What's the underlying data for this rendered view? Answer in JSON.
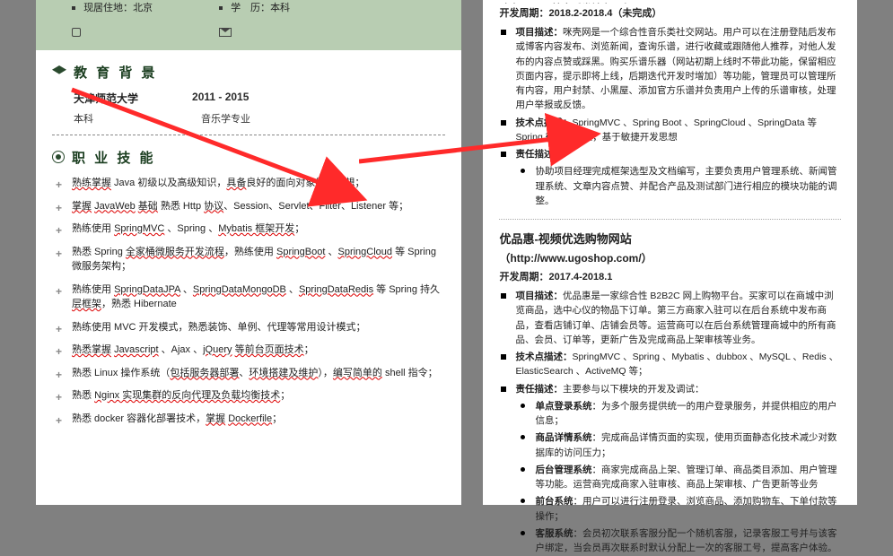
{
  "left": {
    "header": {
      "residence_label": "现居住地：",
      "residence": "北京",
      "edu_label": "学　历：",
      "edu": "本科"
    },
    "edu_section_title": "教 育 背 景",
    "education": {
      "school": "天津师范大学",
      "years": "2011 - 2015",
      "degree": "本科",
      "major": "音乐学专业"
    },
    "skill_section_title": "职 业 技 能",
    "skills": [
      {
        "p1": "熟练掌握 Java 初级以及高级知识，具备良好的面向对象编程思想；",
        "wavy": [
          "熟练掌握",
          "具备"
        ]
      },
      {
        "p1": "掌握 JavaWeb 基础 熟悉 Http 协议、Session、Servlet、Filter、Listener 等；",
        "wavy": [
          "掌握",
          "JavaWeb",
          "基础",
          "协议"
        ]
      },
      {
        "p1": "熟练使用 SpringMVC 、Spring 、Mybatis 框架开发；",
        "wavy": [
          "SpringMVC",
          "Mybatis 框架开发"
        ]
      },
      {
        "p1": "熟悉 Spring 全家桶微服务开发流程，熟练使用 SpringBoot 、SpringCloud 等 Spring 微服务架构；",
        "wavy": [
          "全家桶微服务开发流程",
          "SpringBoot",
          "SpringCloud"
        ]
      },
      {
        "p1": "熟练使用 SpringDataJPA 、SpringDataMongoDB 、SpringDataRedis 等 Spring 持久层框架，熟悉 Hibernate",
        "wavy": [
          "SpringDataJPA",
          "SpringDataMongoDB",
          "SpringDataRedis",
          "层框架"
        ]
      },
      {
        "p1": "熟练使用 MVC 开发模式，熟悉装饰、单例、代理等常用设计模式；",
        "wavy": []
      },
      {
        "p1": "熟悉掌握 Javascript 、Ajax 、jQuery 等前台页面技术；",
        "wavy": [
          "熟悉掌握",
          "Javascript",
          "jQuery",
          "等前台页面技术"
        ]
      },
      {
        "p1": "熟悉 Linux 操作系统（包括服务器部署、环境搭建及维护），编写简单的 shell 指令；",
        "wavy": [
          "包括服务器部署",
          "环境搭建及维护",
          "编写简单的"
        ]
      },
      {
        "p1": "熟悉 Nginx 实现集群的反向代理及负载均衡技术；",
        "wavy": [
          "Nginx 实现集群的反向代理及负载均衡技术"
        ]
      },
      {
        "p1": "熟悉 docker 容器化部署技术，掌握 Dockerfile；",
        "wavy": [
          "掌握",
          "Dockerfile"
        ]
      }
    ]
  },
  "right": {
    "proj1": {
      "title_prefix": "咪壳网-项目性音乐类社交平台",
      "period_label": "开发周期：",
      "period": "2018.2-2018.4（未完成）",
      "desc_label": "项目描述：",
      "desc": "咪壳网是一个综合性音乐类社交网站。用户可以在注册登陆后发布或博客内容发布、浏览新闻，查询乐谱，进行收藏或跟随他人推荐，对他人发布的内容点赞或踩黑。购买乐谱乐器（网站初期上线时不带此功能，保留相应页面内容，提示即将上线，后期迭代开发时增加）等功能，管理员可以管理所有内容，用户封禁、小黑屋、添加官方乐谱并负责用户上传的乐谱审核，处理用户举报或反馈。",
      "tech_label": "技术点描述：",
      "tech": "SpringMVC 、Spring Boot 、SpringCloud 、SpringData 等 Spring 微服务框架，基于敏捷开发思想",
      "resp_label": "责任描述：",
      "resp": "协助项目经理完成框架选型及文档编写，主要负责用户管理系统、新闻管理系统、文章内容点赞、并配合产品及测试部门进行相应的模块功能的调整。"
    },
    "proj2": {
      "title": "优品惠-视频优选购物网站",
      "url_label": "（http://www.ugoshop.com/）",
      "period_label": "开发周期：",
      "period": "2017.4-2018.1",
      "desc_label": "项目描述：",
      "desc": "优品惠是一家综合性 B2B2C 网上购物平台。买家可以在商城中浏览商品，选中心仪的物品下订单。第三方商家入驻可以在后台系统中发布商品，查看店铺订单、店铺会员等。运营商可以在后台系统管理商城中的所有商品、会员、订单等，更新广告及完成商品上架审核等业务。",
      "tech_label": "技术点描述：",
      "tech": "SpringMVC 、Spring 、Mybatis 、dubbox 、MySQL 、Redis 、ElasticSearch 、ActiveMQ 等；",
      "resp_label": "责任描述：",
      "resp_intro": "主要参与以下模块的开发及调试：",
      "modules": [
        {
          "name": "单点登录系统",
          "text": "：为多个服务提供统一的用户登录服务，并提供相应的用户信息；"
        },
        {
          "name": "商品详情系统",
          "text": "：完成商品详情页面的实现，使用页面静态化技术减少对数据库的访问压力；"
        },
        {
          "name": "后台管理系统",
          "text": "：商家完成商品上架、管理订单、商品类目添加、用户管理等功能。运营商完成商家入驻审核、商品上架审核、广告更新等业务"
        },
        {
          "name": "前台系统",
          "text": "：用户可以进行注册登录、浏览商品、添加购物车、下单付款等操作；"
        },
        {
          "name": "客服系统",
          "text": "：会员初次联系客服分配一个随机客服，记录客服工号并与该客户绑定，当会员再次联系时默认分配上一次的客服工号，提高客户体验。"
        }
      ]
    }
  }
}
